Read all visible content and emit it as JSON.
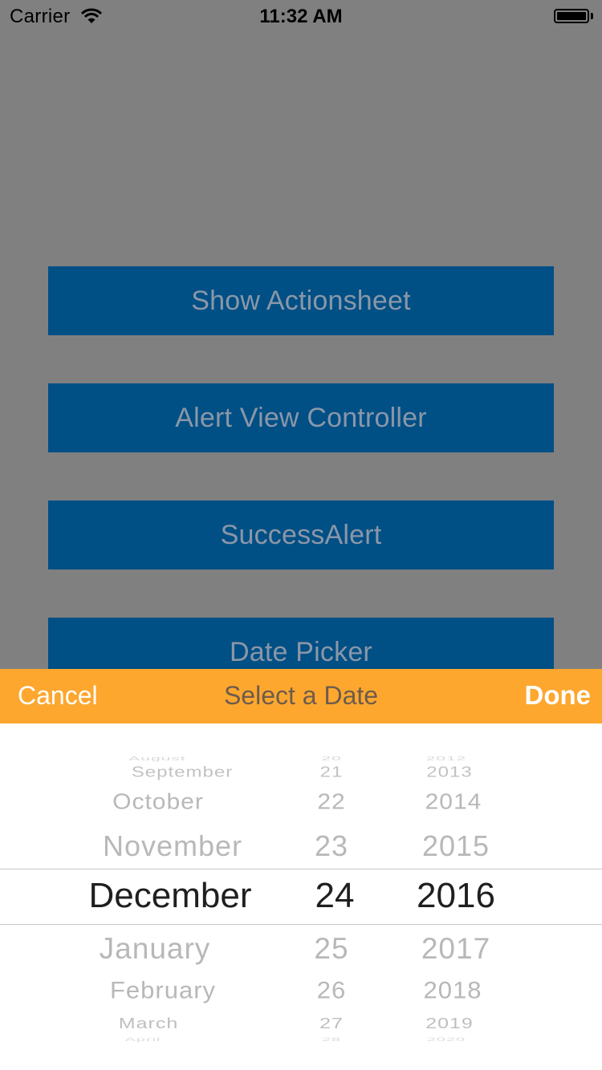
{
  "status_bar": {
    "carrier": "Carrier",
    "time": "11:32 AM"
  },
  "buttons": [
    {
      "label": "Show Actionsheet"
    },
    {
      "label": "Alert View Controller"
    },
    {
      "label": "SuccessAlert"
    },
    {
      "label": "Date Picker"
    }
  ],
  "toolbar": {
    "cancel": "Cancel",
    "title": "Select a Date",
    "done": "Done"
  },
  "date_picker": {
    "months": [
      "August",
      "September",
      "October",
      "November",
      "December",
      "January",
      "February",
      "March",
      "April"
    ],
    "days": [
      "20",
      "21",
      "22",
      "23",
      "24",
      "25",
      "26",
      "27",
      "28"
    ],
    "years": [
      "2012",
      "2013",
      "2014",
      "2015",
      "2016",
      "2017",
      "2018",
      "2019",
      "2020"
    ],
    "selected": {
      "month": "December",
      "day": "24",
      "year": "2016"
    }
  },
  "colors": {
    "overlay": "#808080",
    "button_bg": "#004f85",
    "button_text": "#8a97a8",
    "toolbar_bg": "#fda72f",
    "picker_bg": "#ffffff"
  }
}
